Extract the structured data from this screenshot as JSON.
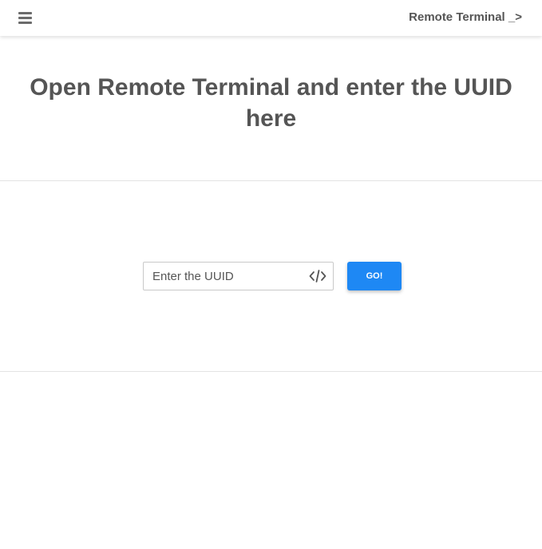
{
  "navbar": {
    "menu_icon": "hamburger-menu-icon",
    "brand": "Remote Terminal _>"
  },
  "hero": {
    "title": "Open Remote Terminal and enter the UUID here"
  },
  "form": {
    "uuid_placeholder": "Enter the UUID",
    "uuid_value": "",
    "input_icon": "code-icon",
    "go_label": "GO!"
  },
  "colors": {
    "accent": "#1e88f4",
    "text": "#555555",
    "divider": "#e3e3e3"
  }
}
